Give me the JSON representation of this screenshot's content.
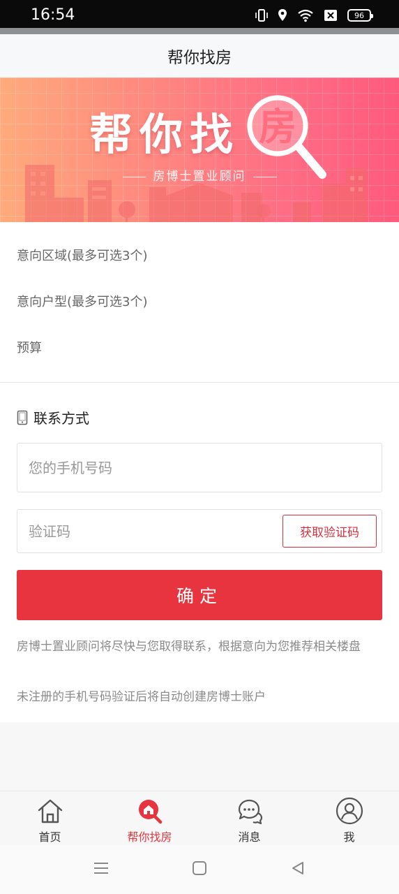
{
  "status_bar": {
    "time": "16:54",
    "battery": "96"
  },
  "header": {
    "title": "帮你找房"
  },
  "banner": {
    "title_chars": "帮你找",
    "title_circle_char": "房",
    "subtitle": "房博士置业顾问"
  },
  "preferences": {
    "area_label": "意向区域(最多可选3个)",
    "layout_label": "意向户型(最多可选3个)",
    "budget_label": "预算"
  },
  "contact": {
    "section_title": "联系方式",
    "phone_placeholder": "您的手机号码",
    "code_placeholder": "验证码",
    "get_code_label": "获取验证码",
    "confirm_label": "确定",
    "note_1": "房博士置业顾问将尽快与您取得联系，根据意向为您推荐相关楼盘",
    "note_2": "未注册的手机号码验证后将自动创建房博士账户"
  },
  "tabs": [
    {
      "label": "首页",
      "icon": "home-icon",
      "active": false
    },
    {
      "label": "帮你找房",
      "icon": "house-search-icon",
      "active": true
    },
    {
      "label": "消息",
      "icon": "chat-icon",
      "active": false
    },
    {
      "label": "我",
      "icon": "user-icon",
      "active": false
    }
  ],
  "colors": {
    "accent": "#e8343f",
    "banner_start": "#ffaa7c",
    "banner_end": "#ff5a7c"
  }
}
